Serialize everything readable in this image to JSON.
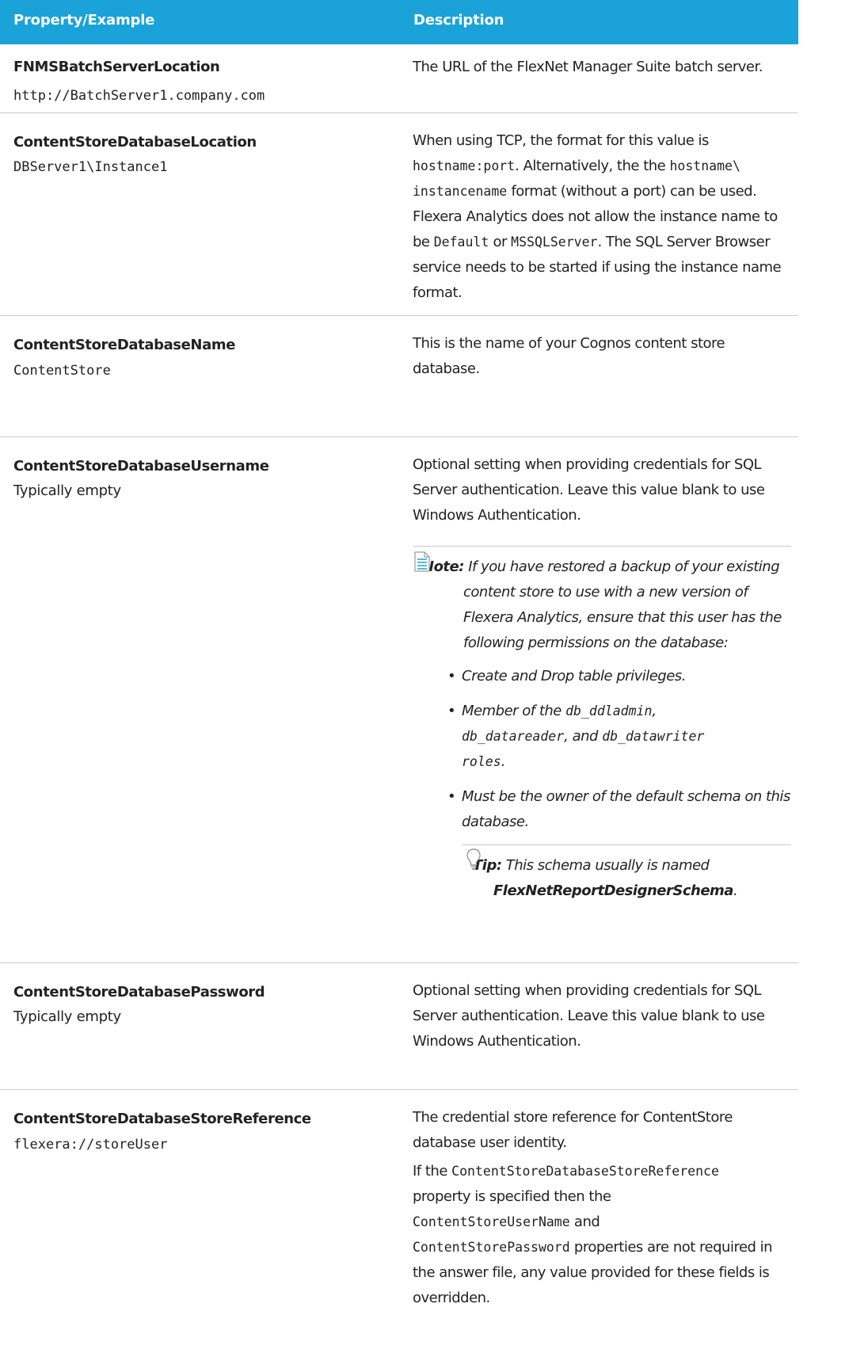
{
  "header": {
    "col1": "Property/Example",
    "col2": "Description"
  },
  "rows": [
    {
      "name": "FNMSBatchServerLocation",
      "example": "http://BatchServer1.company.com",
      "desc": "The URL of the FlexNet Manager Suite batch server."
    },
    {
      "name": "ContentStoreDatabaseLocation",
      "example": "DBServer1\\Instance1",
      "desc": {
        "t1": "When using TCP, the format for this value is",
        "c1": "hostname:port",
        "t2": ". Alternatively, the",
        "c2": "hostname\\",
        "c3": "instancename",
        "t3": "format (without a port) can be used. Flexera Analytics does not allow the instance name to be",
        "c4": "Default",
        "t4": "or",
        "c5": "MSSQLServer",
        "t5": ". The SQL Server Browser service needs to be started if using the instance name format."
      }
    },
    {
      "name": "ContentStoreDatabaseName",
      "example": "ContentStore",
      "desc": "This is the name of your Cognos content store database."
    },
    {
      "name": "ContentStoreDatabaseUsername",
      "example": "Typically empty",
      "desc": "Optional setting when providing credentials for SQL Server authentication. Leave this value blank to use Windows Authentication.",
      "note": {
        "label": "Note:",
        "text": "If you have restored a backup of your existing content store to use with a new version of Flexera Analytics, ensure that this user has the following permissions on the database:",
        "bullets": {
          "b1": "Create and Drop table privileges.",
          "b2a": "Member of the",
          "b2c1": "db_ddladmin",
          "b2b": ",",
          "b2c2": "db_datareader",
          "b2d": ", and",
          "b2c3": "db_datawriter",
          "b2e": "roles",
          "b2f": ".",
          "b3": "Must be the owner of the default schema on this database."
        },
        "tip": {
          "label": "Tip:",
          "text": "This schema usually is named",
          "bold": "FlexNetReportDesignerSchema",
          "end": "."
        }
      }
    },
    {
      "name": "ContentStoreDatabasePassword",
      "example": "Typically empty",
      "desc": "Optional setting when providing credentials for SQL Server authentication. Leave this value blank to use Windows Authentication."
    },
    {
      "name": "ContentStoreDatabaseStoreReference",
      "example": "flexera://storeUser",
      "desc": {
        "p1": "The credential store reference for ContentStore database user identity.",
        "t1": "If the",
        "c1": "ContentStoreDatabaseStoreReference",
        "t2": "property is specified then the",
        "c2": "ContentStoreUserName",
        "t3": "and",
        "c3": "ContentStorePassword",
        "t4": "properties are not required in the answer file, any value provided for these fields is overridden."
      }
    }
  ],
  "icons": {
    "note": "document-icon",
    "tip": "lightbulb-icon",
    "accent": "#1aa2d9"
  }
}
